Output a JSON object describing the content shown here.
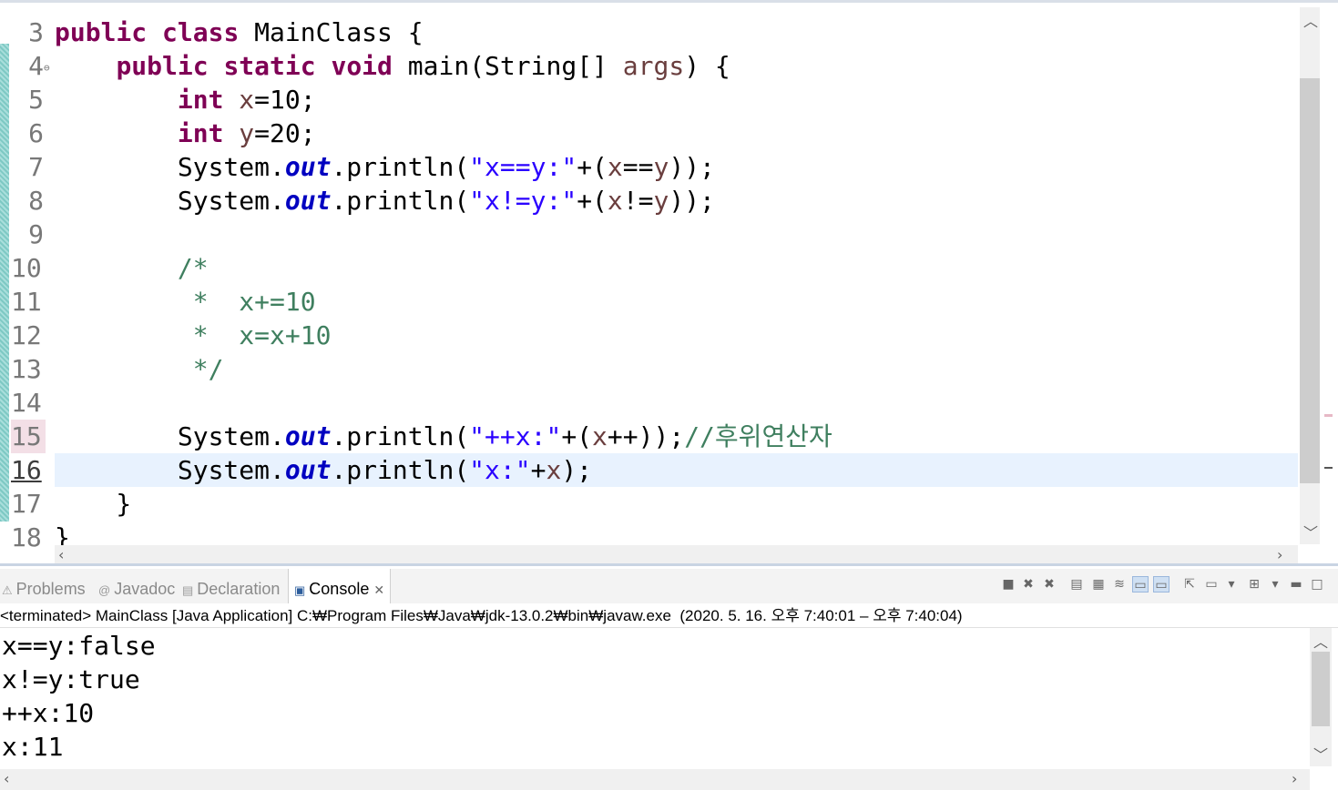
{
  "editor": {
    "lines": [
      {
        "no": "3",
        "tokens": [
          [
            "kw",
            "public"
          ],
          [
            "p",
            " "
          ],
          [
            "kw",
            "class"
          ],
          [
            "p",
            " MainClass {"
          ]
        ]
      },
      {
        "no": "4",
        "tokens": [
          [
            "p",
            "    "
          ],
          [
            "kw",
            "public"
          ],
          [
            "p",
            " "
          ],
          [
            "kw",
            "static"
          ],
          [
            "p",
            " "
          ],
          [
            "kw",
            "void"
          ],
          [
            "p",
            " main(String[] "
          ],
          [
            "var",
            "args"
          ],
          [
            "p",
            ") {"
          ]
        ]
      },
      {
        "no": "5",
        "tokens": [
          [
            "p",
            "        "
          ],
          [
            "kw",
            "int"
          ],
          [
            "p",
            " "
          ],
          [
            "var",
            "x"
          ],
          [
            "p",
            "=10;"
          ]
        ]
      },
      {
        "no": "6",
        "tokens": [
          [
            "p",
            "        "
          ],
          [
            "kw",
            "int"
          ],
          [
            "p",
            " "
          ],
          [
            "var",
            "y"
          ],
          [
            "p",
            "=20;"
          ]
        ]
      },
      {
        "no": "7",
        "tokens": [
          [
            "p",
            "        System."
          ],
          [
            "field",
            "out"
          ],
          [
            "p",
            ".println("
          ],
          [
            "str",
            "\"x==y:\""
          ],
          [
            "p",
            "+("
          ],
          [
            "var",
            "x"
          ],
          [
            "p",
            "=="
          ],
          [
            "var",
            "y"
          ],
          [
            "p",
            "));"
          ]
        ]
      },
      {
        "no": "8",
        "tokens": [
          [
            "p",
            "        System."
          ],
          [
            "field",
            "out"
          ],
          [
            "p",
            ".println("
          ],
          [
            "str",
            "\"x!=y:\""
          ],
          [
            "p",
            "+("
          ],
          [
            "var",
            "x"
          ],
          [
            "p",
            "!="
          ],
          [
            "var",
            "y"
          ],
          [
            "p",
            "));"
          ]
        ]
      },
      {
        "no": "9",
        "tokens": []
      },
      {
        "no": "10",
        "tokens": [
          [
            "p",
            "        "
          ],
          [
            "cmt",
            "/*"
          ]
        ]
      },
      {
        "no": "11",
        "tokens": [
          [
            "p",
            "         "
          ],
          [
            "cmt",
            "*  x+=10"
          ]
        ]
      },
      {
        "no": "12",
        "tokens": [
          [
            "p",
            "         "
          ],
          [
            "cmt",
            "*  x=x+10"
          ]
        ]
      },
      {
        "no": "13",
        "tokens": [
          [
            "p",
            "         "
          ],
          [
            "cmt",
            "*/"
          ]
        ]
      },
      {
        "no": "14",
        "tokens": []
      },
      {
        "no": "15",
        "tokens": [
          [
            "p",
            "        System."
          ],
          [
            "field",
            "out"
          ],
          [
            "p",
            ".println("
          ],
          [
            "str",
            "\"++x:\""
          ],
          [
            "p",
            "+("
          ],
          [
            "var",
            "x"
          ],
          [
            "p",
            "++));"
          ],
          [
            "cmt",
            "//후위연산자"
          ]
        ]
      },
      {
        "no": "16",
        "tokens": [
          [
            "p",
            "        System."
          ],
          [
            "field",
            "out"
          ],
          [
            "p",
            ".println("
          ],
          [
            "str",
            "\"x:\""
          ],
          [
            "p",
            "+"
          ],
          [
            "var",
            "x"
          ],
          [
            "p",
            ");"
          ]
        ]
      },
      {
        "no": "17",
        "tokens": [
          [
            "p",
            "    }"
          ]
        ]
      },
      {
        "no": "18",
        "tokens": [
          [
            "p",
            "}"
          ]
        ]
      }
    ],
    "current_line_index": 13,
    "fold_marker": "⊖"
  },
  "panel": {
    "tabs": [
      {
        "label": "Problems",
        "icon": "problems-icon",
        "glyph": "⚠"
      },
      {
        "label": "Javadoc",
        "icon": "javadoc-icon",
        "glyph": "@"
      },
      {
        "label": "Declaration",
        "icon": "declaration-icon",
        "glyph": "▤"
      },
      {
        "label": "Console",
        "icon": "console-icon",
        "glyph": "▣",
        "active": true
      }
    ],
    "status": "<terminated> MainClass [Java Application] C:₩Program Files₩Java₩jdk-13.0.2₩bin₩javaw.exe  (2020. 5. 16. 오후 7:40:01 – 오후 7:40:04)"
  },
  "console": {
    "output": [
      "x==y:false",
      "x!=y:true",
      "++x:10",
      "x:11"
    ]
  },
  "colors": {
    "keyword": "#7f0055",
    "string": "#2a00ff",
    "comment": "#3f7f5f",
    "field": "#0000c0",
    "local_var": "#6a3e3e",
    "current_line": "#e8f2fe"
  }
}
